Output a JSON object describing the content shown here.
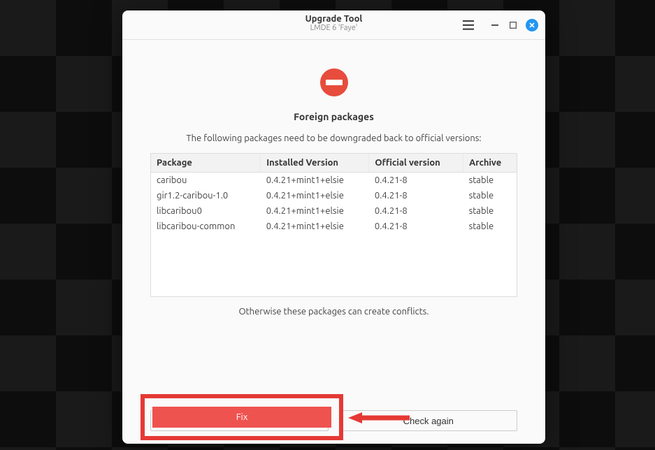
{
  "titlebar": {
    "title": "Upgrade Tool",
    "subtitle": "LMDE 6 'Faye'"
  },
  "page": {
    "heading": "Foreign packages",
    "subheading": "The following packages need to be downgraded back to official versions:",
    "footnote": "Otherwise these packages can create conflicts."
  },
  "table": {
    "headers": [
      "Package",
      "Installed Version",
      "Official version",
      "Archive"
    ],
    "rows": [
      {
        "pkg": "caribou",
        "installed": "0.4.21+mint1+elsie",
        "official": "0.4.21-8",
        "archive": "stable"
      },
      {
        "pkg": "gir1.2-caribou-1.0",
        "installed": "0.4.21+mint1+elsie",
        "official": "0.4.21-8",
        "archive": "stable"
      },
      {
        "pkg": "libcaribou0",
        "installed": "0.4.21+mint1+elsie",
        "official": "0.4.21-8",
        "archive": "stable"
      },
      {
        "pkg": "libcaribou-common",
        "installed": "0.4.21+mint1+elsie",
        "official": "0.4.21-8",
        "archive": "stable"
      }
    ]
  },
  "buttons": {
    "fix": "Fix",
    "check_again": "Check again"
  },
  "annotation": {
    "highlight_color": "#e53935",
    "arrow_color": "#e53935"
  }
}
